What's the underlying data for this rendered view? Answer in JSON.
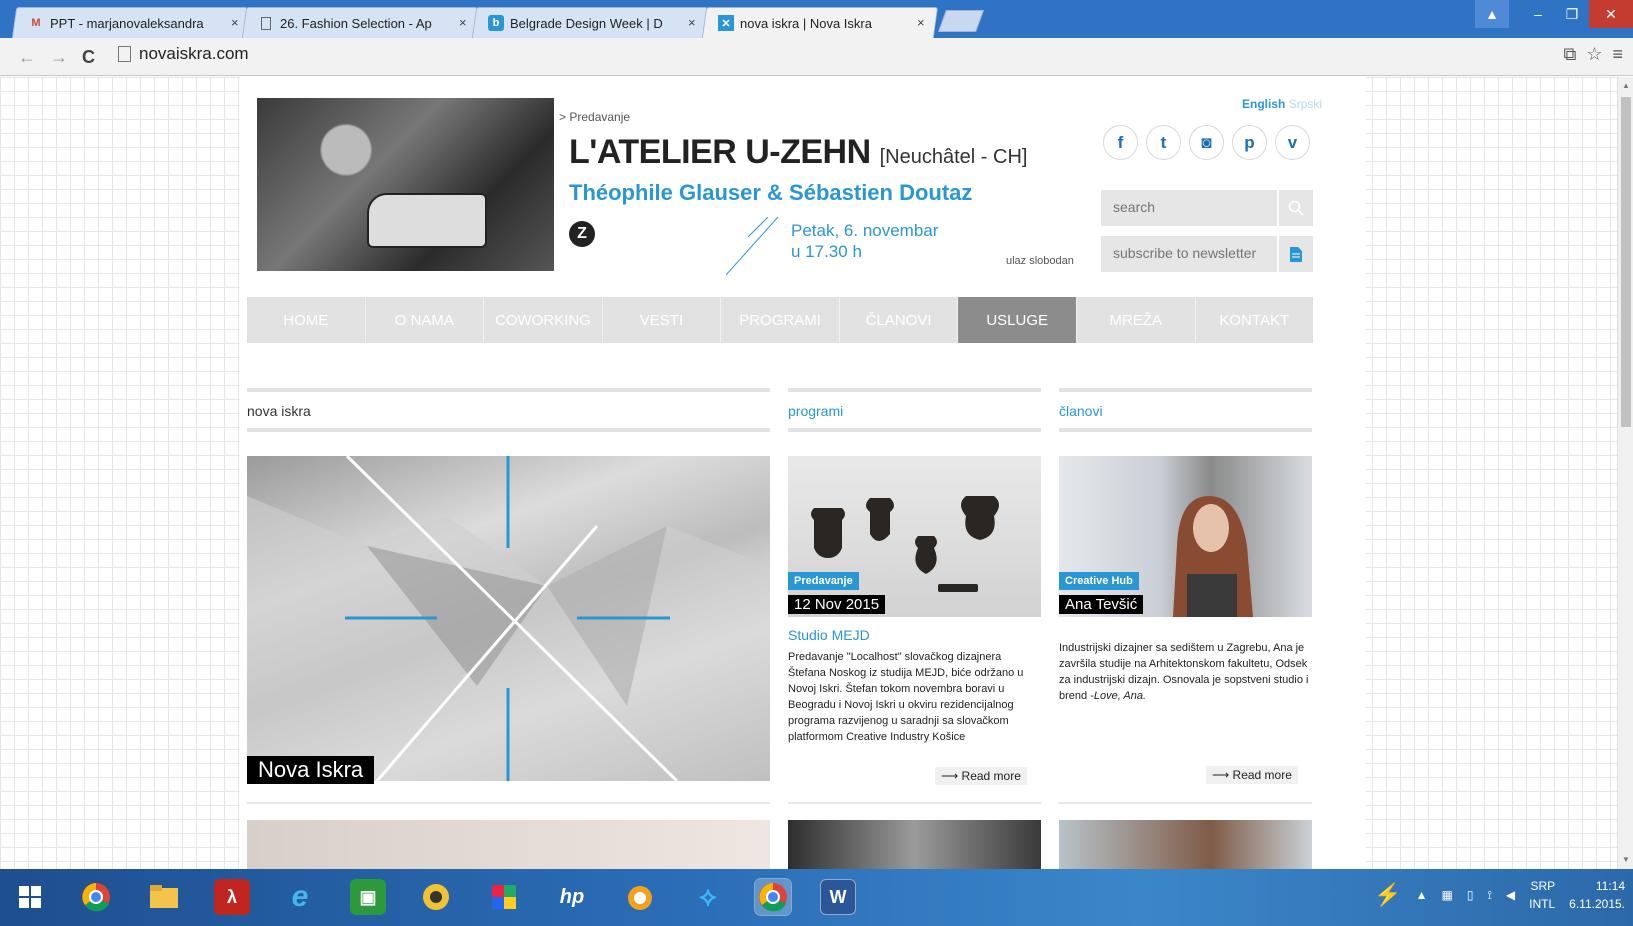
{
  "browser": {
    "tabs": [
      {
        "label": "PPT - marjanovaleksandra",
        "favicon": "gmail-icon",
        "close": "×"
      },
      {
        "label": "26. Fashion Selection - Ap",
        "favicon": "page-icon",
        "close": "×"
      },
      {
        "label": "Belgrade Design Week | D",
        "favicon": "bdw-icon",
        "close": "×"
      },
      {
        "label": "nova iskra | Nova Iskra",
        "favicon": "novaiskra-icon",
        "close": "×"
      }
    ],
    "url": "novaiskra.com",
    "window_controls": {
      "minimize": "–",
      "maximize": "❐",
      "close": "✕"
    }
  },
  "header": {
    "kicker": "> Predavanje",
    "title": "L'ATELIER U-ZEHN",
    "location": "[Neuchâtel - CH]",
    "speakers": "Théophile Glauser & Sébastien Doutaz",
    "z_logo": "Z",
    "date_line1": "Petak, 6. novembar",
    "date_line2": "u 17.30 h",
    "entry": "ulaz slobodan",
    "lang_en": "English",
    "lang_sr": "Srpski",
    "socials": [
      {
        "name": "facebook",
        "glyph": "f"
      },
      {
        "name": "twitter",
        "glyph": "t"
      },
      {
        "name": "instagram",
        "glyph": "◙"
      },
      {
        "name": "pinterest",
        "glyph": "p"
      },
      {
        "name": "vimeo",
        "glyph": "v"
      }
    ],
    "search_placeholder": "search",
    "newsletter_placeholder": "subscribe to newsletter"
  },
  "nav": [
    "HOME",
    "O NAMA",
    "COWORKING",
    "VESTI",
    "PROGRAMI",
    "ČLANOVI",
    "USLUGE",
    "MREŽA",
    "KONTAKT"
  ],
  "nav_active": "USLUGE",
  "sections": {
    "main": "nova iskra",
    "programi": "programi",
    "clanovi": "članovi"
  },
  "main_feature": {
    "caption": "Nova Iskra"
  },
  "program_card": {
    "tag": "Predavanje",
    "date": "12 Nov 2015",
    "title": "Studio MEJD",
    "text": "Predavanje \"Localhost\" slovačkog dizajnera Štefana Noskog iz studija MEJD, biće održano u Novoj Iskri. Štefan tokom novembra boravi u Beogradu i Novoj Iskri u okviru rezidencijalnog programa razvijenog u saradnji sa slovačkom platformom Creative Industry Košice",
    "read_more": "⟶ Read more"
  },
  "member_card": {
    "tag": "Creative Hub",
    "name": "Ana Tevšić",
    "text": "Industrijski dizajner sa sedištem u Zagrebu, Ana je završila studije na Arhitektonskom fakultetu, Odsek za industrijski dizajn. Osnovala je sopstveni studio i brend -",
    "text_italic": "Love, Ana.",
    "read_more": "⟶ Read more"
  },
  "taskbar": {
    "lang": "SRP",
    "kbd": "INTL",
    "time": "11:14",
    "date": "6.11.2015.",
    "apps": [
      "windows-start-icon",
      "chrome-icon",
      "file-explorer-icon",
      "acrobat-icon",
      "internet-explorer-icon",
      "store-icon",
      "media-player-icon",
      "paint-icon",
      "hp-icon",
      "messenger-icon",
      "telenor-icon",
      "chrome-icon",
      "word-icon"
    ]
  },
  "colors": {
    "accent": "#2a96d4",
    "nav": "#e2e2e2",
    "nav_active": "#8c8c8c",
    "titlebar": "#2f73c5"
  }
}
